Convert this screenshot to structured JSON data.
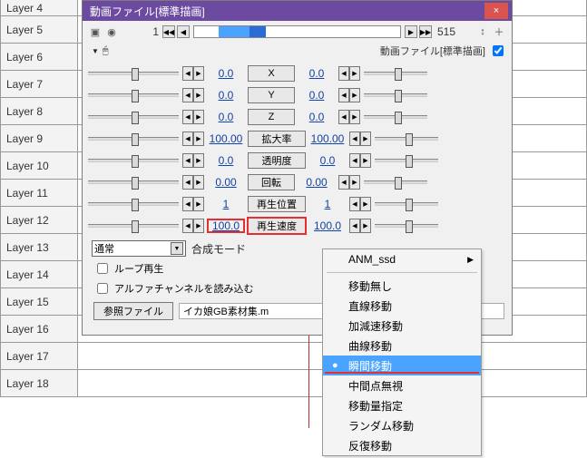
{
  "layers": [
    "Layer 4",
    "Layer 5",
    "Layer 6",
    "Layer 7",
    "Layer 8",
    "Layer 9",
    "Layer 10",
    "Layer 11",
    "Layer 12",
    "Layer 13",
    "Layer 14",
    "Layer 15",
    "Layer 16",
    "Layer 17",
    "Layer 18"
  ],
  "panel": {
    "title": "動画ファイル[標準描画]",
    "close_glyph": "×",
    "frame_current": "1",
    "frame_total": "515",
    "sublabel": "動画ファイル[標準描画]",
    "params": [
      {
        "name": "X",
        "lval": "0.0",
        "btn": "X",
        "rval": "0.0"
      },
      {
        "name": "Y",
        "lval": "0.0",
        "btn": "Y",
        "rval": "0.0"
      },
      {
        "name": "Z",
        "lval": "0.0",
        "btn": "Z",
        "rval": "0.0"
      },
      {
        "name": "scale",
        "lval": "100.00",
        "btn": "拡大率",
        "rval": "100.00"
      },
      {
        "name": "alpha",
        "lval": "0.0",
        "btn": "透明度",
        "rval": "0.0"
      },
      {
        "name": "rotate",
        "lval": "0.00",
        "btn": "回転",
        "rval": "0.00"
      },
      {
        "name": "playpos",
        "lval": "1",
        "btn": "再生位置",
        "rval": "1"
      },
      {
        "name": "playrate",
        "lval": "100.0",
        "btn": "再生速度",
        "rval": "100.0",
        "hl": true
      }
    ],
    "composite_mode_value": "通常",
    "composite_mode_label": "合成モード",
    "loop_label": "ループ再生",
    "alpha_label": "アルファチャンネルを読み込む",
    "ref_button": "参照ファイル",
    "ref_value": "イカ娘GB素材集.m"
  },
  "menu": {
    "anm": "ANM_ssd",
    "items": [
      "移動無し",
      "直線移動",
      "加減速移動",
      "曲線移動",
      "瞬間移動",
      "中間点無視",
      "移動量指定",
      "ランダム移動",
      "反復移動"
    ],
    "highlight_index": 4
  }
}
